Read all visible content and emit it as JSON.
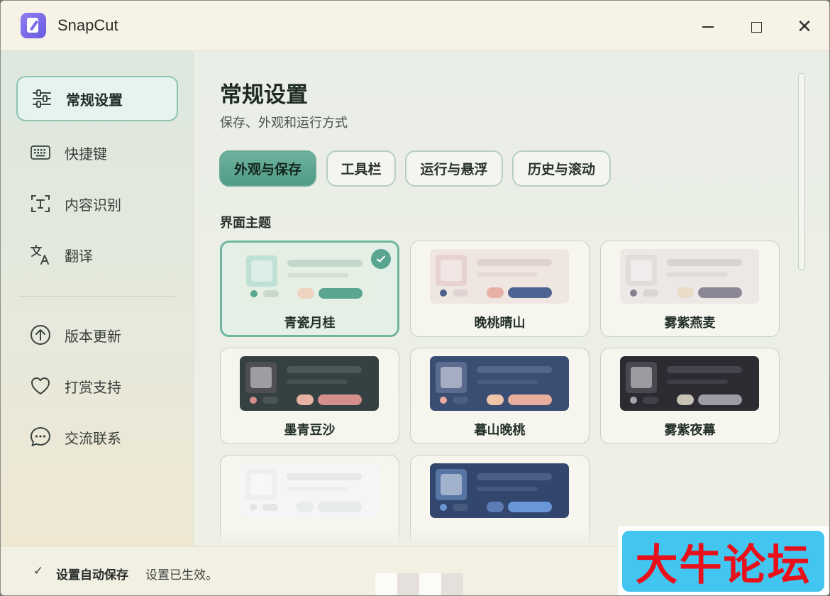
{
  "app": {
    "title": "SnapCut"
  },
  "window_controls": {
    "minimize": "minimize",
    "maximize": "maximize",
    "close": "✕"
  },
  "sidebar": {
    "items": [
      {
        "label": "常规设置",
        "icon": "sliders-icon",
        "active": true
      },
      {
        "label": "快捷键",
        "icon": "keyboard-icon",
        "active": false
      },
      {
        "label": "内容识别",
        "icon": "text-scan-icon",
        "active": false
      },
      {
        "label": "翻译",
        "icon": "translate-icon",
        "active": false
      },
      {
        "label": "版本更新",
        "icon": "arrow-up-circle-icon",
        "active": false
      },
      {
        "label": "打赏支持",
        "icon": "heart-icon",
        "active": false
      },
      {
        "label": "交流联系",
        "icon": "chat-bubble-icon",
        "active": false
      }
    ]
  },
  "main": {
    "title": "常规设置",
    "subtitle": "保存、外观和运行方式",
    "tabs": [
      {
        "label": "外观与保存",
        "active": true
      },
      {
        "label": "工具栏",
        "active": false
      },
      {
        "label": "运行与悬浮",
        "active": false
      },
      {
        "label": "历史与滚动",
        "active": false
      }
    ],
    "section_label": "界面主题",
    "themes": [
      {
        "name": "青瓷月桂",
        "selected": true,
        "bg": "#e6efe4",
        "sq": "#bfe0d4",
        "l1": "#c3d8cd",
        "l2": "#d2e0d6",
        "dot": "#5aa590",
        "s1": "#c8d8cc",
        "s2": "#eed4c0",
        "s3": "#5aa590"
      },
      {
        "name": "晚桃晴山",
        "selected": false,
        "bg": "#efe6e2",
        "sq": "#e8d2cf",
        "l1": "#e0d2cf",
        "l2": "#e6dad6",
        "dot": "#4d5f8c",
        "s1": "#dfd3d3",
        "s2": "#e8b1a6",
        "s3": "#4e6391"
      },
      {
        "name": "雾紫燕麦",
        "selected": false,
        "bg": "#ece8e6",
        "sq": "#e2dcdb",
        "l1": "#d9d3d4",
        "l2": "#e0dbdb",
        "dot": "#868190",
        "s1": "#dbd5d6",
        "s2": "#e8dcc8",
        "s3": "#8c8794"
      },
      {
        "name": "墨青豆沙",
        "selected": false,
        "bg": "#344042",
        "sq": "#4f4e55",
        "l1": "#4d5759",
        "l2": "#465053",
        "dot": "#d78e8c",
        "s1": "#4b5456",
        "s2": "#e7b2a3",
        "s3": "#d48f8c"
      },
      {
        "name": "暮山晚桃",
        "selected": false,
        "bg": "#3a4d72",
        "sq": "#5a6b8f",
        "l1": "#55668a",
        "l2": "#4b5c80",
        "dot": "#e8ab9e",
        "s1": "#4d5e83",
        "s2": "#f0c6a8",
        "s3": "#e7ae9d"
      },
      {
        "name": "雾紫夜幕",
        "selected": false,
        "bg": "#2c2b31",
        "sq": "#49474f",
        "l1": "#46444c",
        "l2": "#3f3d45",
        "dot": "#a5a2ab",
        "s1": "#424048",
        "s2": "#c8c4b5",
        "s3": "#9f9ba6"
      },
      {
        "name": "",
        "selected": false,
        "bg": "#f4f5f4",
        "sq": "#eef0ef",
        "l1": "#e6e8e7",
        "l2": "#eceeed",
        "dot": "#e2e4e3",
        "s1": "#e4e6e5",
        "s2": "#e8eceb",
        "s3": "#e4ebe9"
      },
      {
        "name": "",
        "selected": false,
        "bg": "#33466e",
        "sq": "#5674a4",
        "l1": "#4c5e86",
        "l2": "#46587f",
        "dot": "#6b95d6",
        "s1": "#485a80",
        "s2": "#5b7cb4",
        "s3": "#6a97d8"
      }
    ]
  },
  "status": {
    "check": "✓",
    "main": "设置自动保存",
    "sub": "设置已生效。"
  },
  "watermark": {
    "text": "大牛论坛"
  }
}
